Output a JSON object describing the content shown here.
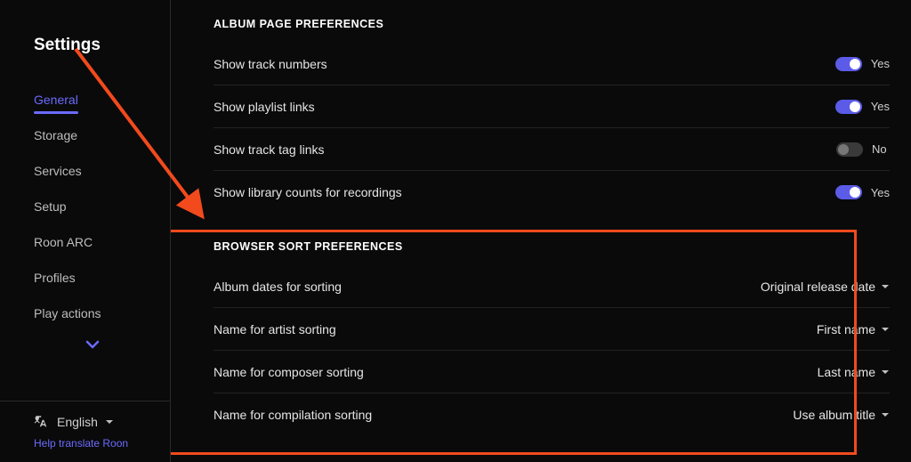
{
  "sidebar": {
    "title": "Settings",
    "items": [
      {
        "label": "General",
        "active": true
      },
      {
        "label": "Storage",
        "active": false
      },
      {
        "label": "Services",
        "active": false
      },
      {
        "label": "Setup",
        "active": false
      },
      {
        "label": "Roon ARC",
        "active": false
      },
      {
        "label": "Profiles",
        "active": false
      },
      {
        "label": "Play actions",
        "active": false
      }
    ],
    "language": "English",
    "help_link": "Help translate Roon"
  },
  "sections": {
    "album": {
      "heading": "ALBUM PAGE PREFERENCES",
      "rows": [
        {
          "label": "Show track numbers",
          "value": "Yes",
          "on": true
        },
        {
          "label": "Show playlist links",
          "value": "Yes",
          "on": true
        },
        {
          "label": "Show track tag links",
          "value": "No",
          "on": false
        },
        {
          "label": "Show library counts for recordings",
          "value": "Yes",
          "on": true
        }
      ]
    },
    "sort": {
      "heading": "BROWSER SORT PREFERENCES",
      "rows": [
        {
          "label": "Album dates for sorting",
          "value": "Original release date"
        },
        {
          "label": "Name for artist sorting",
          "value": "First name"
        },
        {
          "label": "Name for composer sorting",
          "value": "Last name"
        },
        {
          "label": "Name for compilation sorting",
          "value": "Use album title"
        }
      ]
    }
  }
}
